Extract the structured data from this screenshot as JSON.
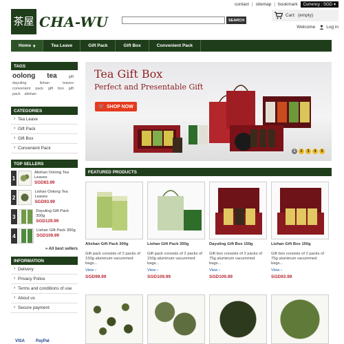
{
  "top_links": {
    "contact": "contact",
    "sitemap": "sitemap",
    "bookmark": "bookmark",
    "currency": "Currency : SGD"
  },
  "logo": {
    "mark": "茶屋",
    "text": "CHA-WU"
  },
  "search": {
    "placeholder": "",
    "button": "SEARCH"
  },
  "cart": {
    "label": "Cart:",
    "status": "(empty)"
  },
  "account": {
    "welcome": "Welcome",
    "login": "Log in"
  },
  "nav": [
    {
      "label": "Home",
      "active": true
    },
    {
      "label": "Tea Leave"
    },
    {
      "label": "Gift Pack"
    },
    {
      "label": "Gift Box"
    },
    {
      "label": "Convenient Pack"
    }
  ],
  "sidebar": {
    "tags_title": "TAGS",
    "tags": {
      "big1": "oolong",
      "big2": "tea",
      "s_gift": "gift",
      "s_dayuling": "dayuling",
      "s_lishan": "lishan",
      "s_leaves": "leaves",
      "s_convenient": "convenient",
      "s_pack": "pack",
      "s_gift2": "gift",
      "s_box": "box",
      "s_gift3": "gift",
      "s_pack2": "pack",
      "s_alishan": "alishan"
    },
    "categories_title": "CATEGORIES",
    "categories": [
      "Tea Leave",
      "Gift Pack",
      "Gift Box",
      "Convenient Pack"
    ],
    "top_sellers_title": "TOP SELLERS",
    "top_sellers": [
      {
        "num": "1",
        "name": "Alishan Oolong Tea Leaves",
        "price": "SGD83.99"
      },
      {
        "num": "2",
        "name": "Lishan Oolong Tea Leaves",
        "price": "SGD93.99"
      },
      {
        "num": "3",
        "name": "Dayuling Gift Pack 300g",
        "price": "SGD129.99"
      },
      {
        "num": "4",
        "name": "Lishan Gift Pack 300g",
        "price": "SGD109.99"
      }
    ],
    "all_best": "» All best sellers",
    "information_title": "INFORMATION",
    "information": [
      "Delivery",
      "Privacy Police",
      "Terms and conditions of use",
      "About us",
      "Secure payment"
    ],
    "payment": {
      "visa": "VISA",
      "paypal": "PayPal"
    }
  },
  "banner": {
    "title": "Tea Gift Box",
    "subtitle": "Perfect and Presentable Gift",
    "shop_now": "SHOP NOW",
    "pages": [
      "1",
      "2",
      "3",
      "4",
      "5"
    ],
    "active_page": 1
  },
  "featured": {
    "title": "FEATURED PRODUCTS",
    "products": [
      {
        "name": "Alishan Gift Pack 300g",
        "desc": "Gift pack consists of 2 packs of 150g aluminum vacummed bags...",
        "view": "View",
        "price": "SGD99.99"
      },
      {
        "name": "Lishan Gift Pack 300g",
        "desc": "Gift pack consists of 2 packs of 150g aluminum vacummed bags...",
        "view": "View",
        "price": "SGD109.99"
      },
      {
        "name": "Dayuling Gift Box 150g",
        "desc": "Gift box consists of 2 packs of 75g aluminum vacummed bags...",
        "view": "View",
        "price": "SGD109.99"
      },
      {
        "name": "Lishan Gift Box 150g",
        "desc": "Gift box consists of 2 packs of 75g aluminum vacummed bags...",
        "view": "View",
        "price": "SGD93.99"
      }
    ]
  },
  "colors": {
    "brand_green": "#1f3d1a",
    "price_red": "#b8242e",
    "link_blue": "#1a56a8"
  }
}
